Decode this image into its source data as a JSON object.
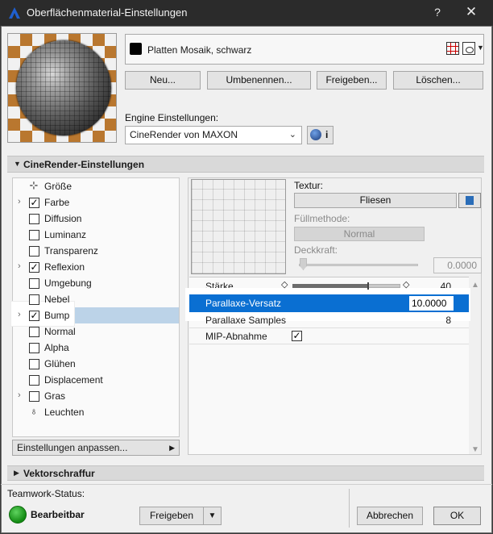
{
  "window": {
    "title": "Oberflächenmaterial-Einstellungen",
    "help": "?",
    "close": "✕"
  },
  "material": {
    "name": "Platten Mosaik, schwarz",
    "swatch_color": "#000000"
  },
  "actions": {
    "new": "Neu...",
    "rename": "Umbenennen...",
    "share": "Freigeben...",
    "delete": "Löschen..."
  },
  "engine": {
    "label": "Engine Einstellungen:",
    "value": "CineRender von MAXON",
    "info": "i"
  },
  "cinerender": {
    "title": "CineRender-Einstellungen",
    "channels": [
      {
        "label": "Größe",
        "checked": null,
        "expander": false,
        "icon": "size-icon"
      },
      {
        "label": "Farbe",
        "checked": true,
        "expander": true
      },
      {
        "label": "Diffusion",
        "checked": false,
        "expander": false
      },
      {
        "label": "Luminanz",
        "checked": false,
        "expander": false
      },
      {
        "label": "Transparenz",
        "checked": false,
        "expander": false
      },
      {
        "label": "Reflexion",
        "checked": true,
        "expander": true
      },
      {
        "label": "Umgebung",
        "checked": false,
        "expander": false
      },
      {
        "label": "Nebel",
        "checked": false,
        "expander": false
      },
      {
        "label": "Bump",
        "checked": true,
        "expander": true,
        "selected": true
      },
      {
        "label": "Normal",
        "checked": false,
        "expander": false
      },
      {
        "label": "Alpha",
        "checked": false,
        "expander": false
      },
      {
        "label": "Glühen",
        "checked": false,
        "expander": false
      },
      {
        "label": "Displacement",
        "checked": false,
        "expander": false
      },
      {
        "label": "Gras",
        "checked": false,
        "expander": true
      },
      {
        "label": "Leuchten",
        "checked": null,
        "expander": false,
        "icon": "light-icon"
      }
    ],
    "customize": "Einstellungen anpassen...",
    "texture": {
      "label": "Textur:",
      "button": "Fliesen"
    },
    "fill": {
      "label": "Füllmethode:",
      "value": "Normal"
    },
    "opacity": {
      "label": "Deckkraft:",
      "value": "0.0000"
    },
    "params": {
      "strength": {
        "label": "Stärke",
        "value": "40",
        "level": 0.7
      },
      "parallax_offset": {
        "label": "Parallaxe-Versatz",
        "value": "10.0000"
      },
      "parallax_samples": {
        "label": "Parallaxe Samples",
        "value": "8"
      },
      "mip": {
        "label": "MIP-Abnahme",
        "checked": true
      }
    }
  },
  "vector_hatch": {
    "title": "Vektorschraffur"
  },
  "teamwork": {
    "label": "Teamwork-Status:",
    "status": "Bearbeitbar",
    "status_color": "#128a12",
    "release": "Freigeben"
  },
  "footer": {
    "cancel": "Abbrechen",
    "ok": "OK"
  }
}
